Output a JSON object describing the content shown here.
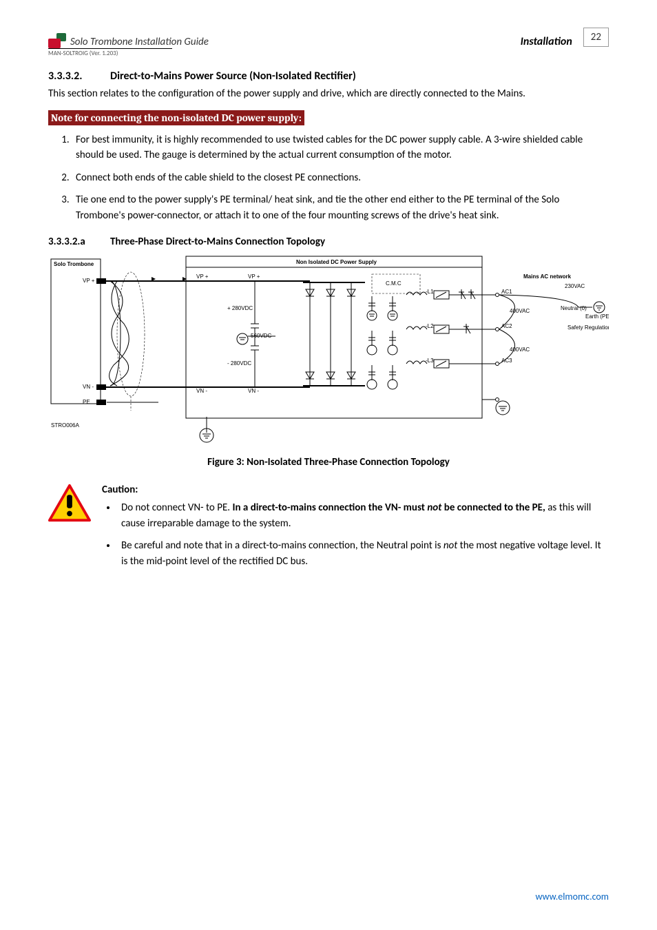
{
  "header": {
    "guide_title": "Solo Trombone Installation Guide",
    "section": "Installation",
    "page_number": "22",
    "ver_line": "MAN-SOLTROIG (Ver. 1.203)"
  },
  "sec_3332": {
    "num": "3.3.3.2.",
    "title": "Direct-to-Mains Power Source (Non-Isolated Rectifier)",
    "intro": "This section relates to the configuration of the power supply and drive, which are directly connected to the Mains.",
    "note_bar": "Note for connecting the non-isolated DC power supply:",
    "items": [
      "For best immunity, it is highly recommended to use twisted cables for the DC power supply cable. A 3-wire shielded cable should be used. The gauge is determined by the actual current consumption of the motor.",
      "Connect both ends of the cable shield to the closest PE connections.",
      "Tie one end to the power supply's PE terminal/ heat sink, and tie the other end either to the PE terminal of the Solo Trombone's power-connector, or attach it to one of the four mounting screws of the drive's heat sink."
    ]
  },
  "sec_3332a": {
    "num": "3.3.3.2.a",
    "title": "Three-Phase Direct-to-Mains Connection Topology"
  },
  "diagram": {
    "title_box": "Non Isolated DC Power Supply",
    "left_box": "Solo Trombone",
    "vp": "VP +",
    "vn": "VN -",
    "pe": "PE",
    "ref": "STRO006A",
    "volt_p": "+ 280VDC",
    "volt_mid": "560VDC",
    "volt_n": "- 280VDC",
    "cmc": "C.M.C",
    "mains_title": "Mains AC network",
    "v230": "230VAC",
    "v400a": "400VAC",
    "v400b": "400VAC",
    "ac1": "AC1",
    "ac2": "AC2",
    "ac3": "AC3",
    "neutral": "Neutral (0)",
    "earth": "Earth (PE)",
    "safety": "Safety Regulations",
    "l1": "-L1",
    "l2": "-L2",
    "l3": "-L3"
  },
  "figure_caption": "Figure 3: Non-Isolated Three-Phase Connection Topology",
  "caution": {
    "title": "Caution:",
    "b1_pre": "Do not connect VN- to PE. ",
    "b1_bold1": "In a direct-to-mains connection the VN- must ",
    "b1_ital": "not",
    "b1_bold2": " be connected to the PE,",
    "b1_post": " as this will cause irreparable damage to the system.",
    "b2_pre": "Be careful and note that in a direct-to-mains connection, the Neutral point is ",
    "b2_ital": "not",
    "b2_post": " the most negative voltage level. It is the mid-point level of the rectified DC bus."
  },
  "footer": {
    "url": "www.elmomc.com"
  }
}
